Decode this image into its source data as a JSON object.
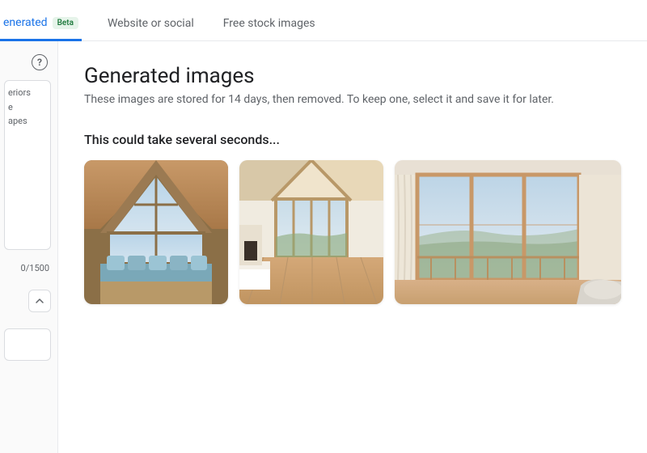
{
  "tabs": {
    "generated": {
      "label": "enerated",
      "badge": "Beta"
    },
    "website": {
      "label": "Website or social"
    },
    "stock": {
      "label": "Free stock images"
    }
  },
  "sidebar": {
    "prompt_text": "eriors\ne\napes",
    "char_count": "0/1500"
  },
  "main": {
    "heading": "Generated images",
    "subtitle": "These images are stored for 14 days, then removed. To keep one, select it and save it for later.",
    "status": "This could take several seconds..."
  },
  "images": {
    "alt1": "interior-aframe",
    "alt2": "interior-bedroom",
    "alt3": "interior-sliding-doors"
  }
}
